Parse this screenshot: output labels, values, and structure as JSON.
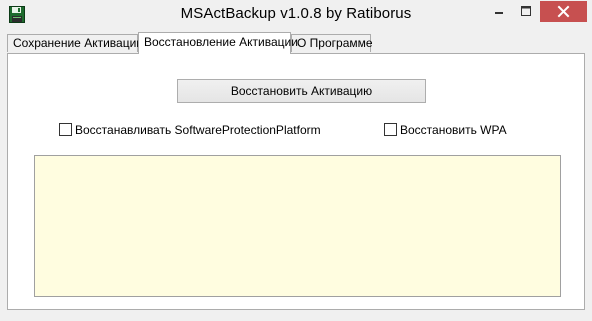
{
  "window": {
    "title": "MSActBackup v1.0.8 by Ratiborus",
    "icon": "floppy-disk-icon",
    "controls": {
      "minimize_icon": "minimize-icon",
      "maximize_icon": "maximize-icon",
      "close_icon": "close-icon",
      "close_color": "#c75050"
    }
  },
  "tabs": [
    {
      "label": "Сохранение Активации",
      "active": false
    },
    {
      "label": "Восстановление Активации",
      "active": true
    },
    {
      "label": "О Программе",
      "active": false
    }
  ],
  "restore_panel": {
    "restore_button_label": "Восстановить Активацию",
    "checkboxes": [
      {
        "label": "Восстанавливать SoftwareProtectionPlatform",
        "checked": false
      },
      {
        "label": "Восстановить WPA",
        "checked": false
      }
    ],
    "log": {
      "value": "",
      "background": "#fffde0"
    }
  }
}
